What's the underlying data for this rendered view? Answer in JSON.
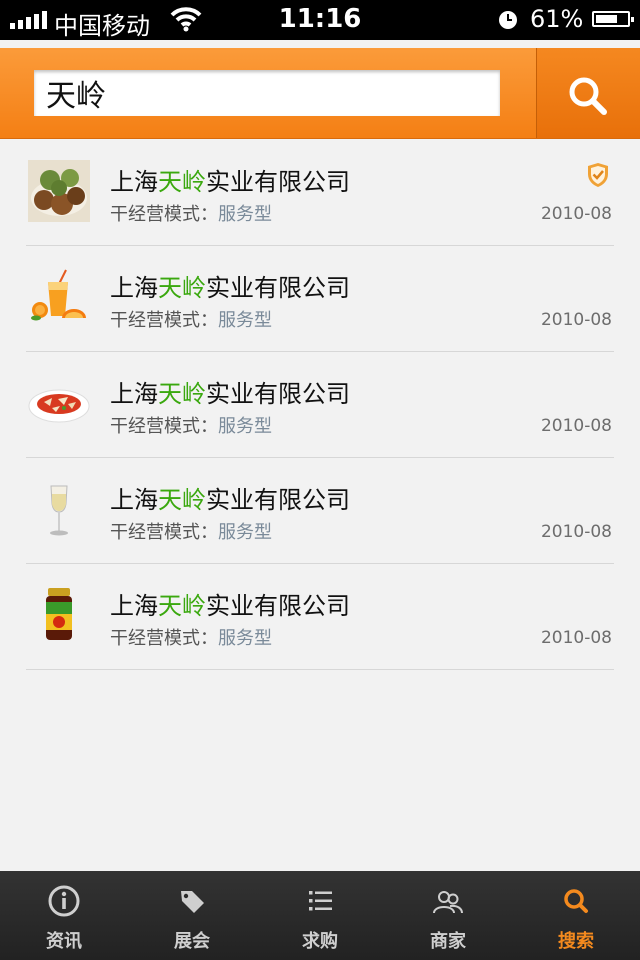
{
  "status_bar": {
    "carrier": "中国移动",
    "time": "11:16",
    "battery": "61%"
  },
  "search": {
    "value": "天岭",
    "placeholder": ""
  },
  "results": [
    {
      "title_prefix": "上海",
      "title_highlight": "天岭",
      "title_suffix": "实业有限公司",
      "mode_label": "干经营模式：",
      "mode_value": "服务型",
      "date": "2010-08",
      "verified": true,
      "thumb": "walnut-pastries"
    },
    {
      "title_prefix": "上海",
      "title_highlight": "天岭",
      "title_suffix": "实业有限公司",
      "mode_label": "干经营模式：",
      "mode_value": "服务型",
      "date": "2010-08",
      "verified": false,
      "thumb": "orange-juice"
    },
    {
      "title_prefix": "上海",
      "title_highlight": "天岭",
      "title_suffix": "实业有限公司",
      "mode_label": "干经营模式：",
      "mode_value": "服务型",
      "date": "2010-08",
      "verified": false,
      "thumb": "spicy-dish"
    },
    {
      "title_prefix": "上海",
      "title_highlight": "天岭",
      "title_suffix": "实业有限公司",
      "mode_label": "干经营模式：",
      "mode_value": "服务型",
      "date": "2010-08",
      "verified": false,
      "thumb": "wine-glass"
    },
    {
      "title_prefix": "上海",
      "title_highlight": "天岭",
      "title_suffix": "实业有限公司",
      "mode_label": "干经营模式：",
      "mode_value": "服务型",
      "date": "2010-08",
      "verified": false,
      "thumb": "sauce-jar"
    }
  ],
  "tabs": [
    {
      "label": "资讯",
      "icon": "info-icon",
      "active": false
    },
    {
      "label": "展会",
      "icon": "tag-icon",
      "active": false
    },
    {
      "label": "求购",
      "icon": "list-icon",
      "active": false
    },
    {
      "label": "商家",
      "icon": "users-icon",
      "active": false
    },
    {
      "label": "搜索",
      "icon": "search-icon",
      "active": true
    }
  ],
  "colors": {
    "accent": "#f48a1e",
    "highlight": "#3aa80e",
    "tabbar": "#2a2a2a"
  }
}
